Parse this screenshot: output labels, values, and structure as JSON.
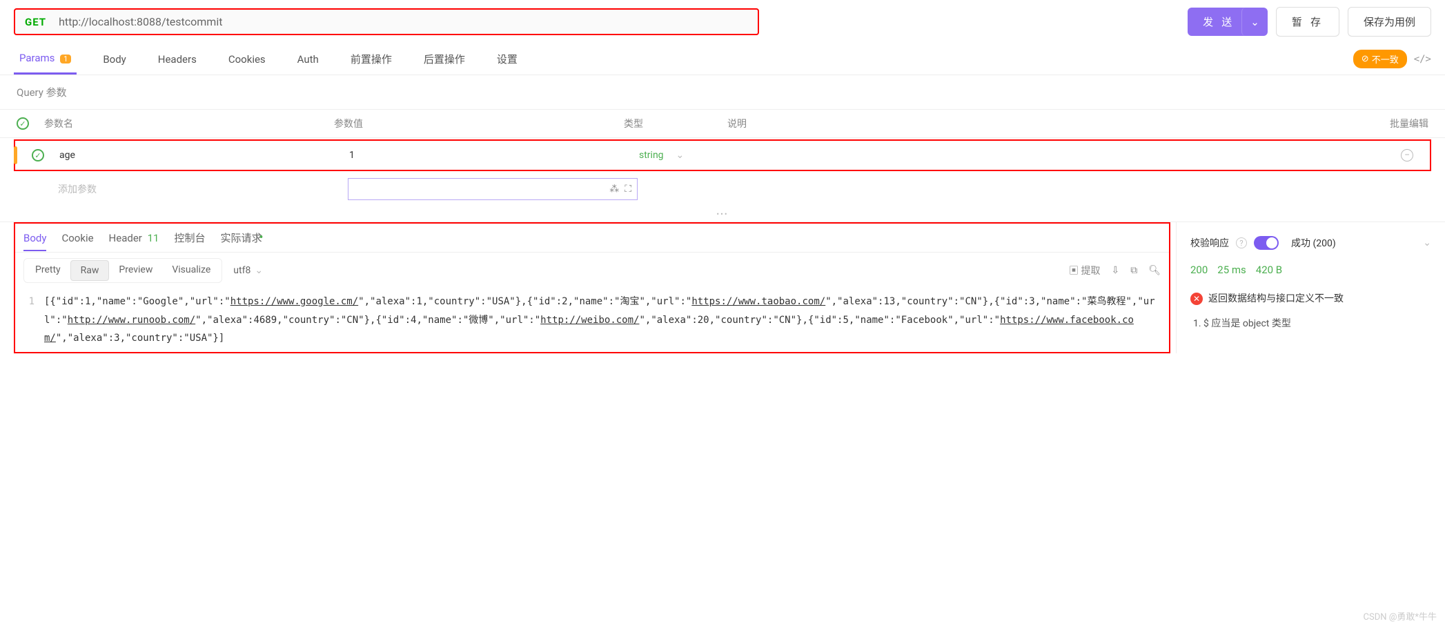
{
  "request": {
    "method": "GET",
    "url": "http://localhost:8088/testcommit"
  },
  "actions": {
    "send": "发 送",
    "save": "暂 存",
    "save_as_case": "保存为用例"
  },
  "tabs": {
    "params": "Params",
    "params_count": "1",
    "body": "Body",
    "headers": "Headers",
    "cookies": "Cookies",
    "auth": "Auth",
    "pre_request": "前置操作",
    "post_request": "后置操作",
    "settings": "设置",
    "mismatch": "不一致"
  },
  "query": {
    "title": "Query 参数",
    "cols": {
      "name": "参数名",
      "value": "参数值",
      "type": "类型",
      "desc": "说明",
      "bulk": "批量编辑"
    },
    "rows": [
      {
        "name": "age",
        "value": "1",
        "type": "string"
      }
    ],
    "add_placeholder": "添加参数"
  },
  "response": {
    "tabs": {
      "body": "Body",
      "cookie": "Cookie",
      "header": "Header",
      "header_count": "11",
      "console": "控制台",
      "actual": "实际请求"
    },
    "views": {
      "pretty": "Pretty",
      "raw": "Raw",
      "preview": "Preview",
      "visualize": "Visualize",
      "encoding": "utf8"
    },
    "extract": "提取",
    "body_text": "[{\"id\":1,\"name\":\"Google\",\"url\":\"https://www.google.cm/\",\"alexa\":1,\"country\":\"USA\"},{\"id\":2,\"name\":\"淘宝\",\"url\":\"https://www.taobao.com/\",\"alexa\":13,\"country\":\"CN\"},{\"id\":3,\"name\":\"菜鸟教程\",\"url\":\"http://www.runoob.com/\",\"alexa\":4689,\"country\":\"CN\"},{\"id\":4,\"name\":\"微博\",\"url\":\"http://weibo.com/\",\"alexa\":20,\"country\":\"CN\"},{\"id\":5,\"name\":\"Facebook\",\"url\":\"https://www.facebook.com/\",\"alexa\":3,\"country\":\"USA\"}]",
    "line_num": "1"
  },
  "sidebar": {
    "validate_label": "校验响应",
    "success_label": "成功 (200)",
    "status_code": "200",
    "time": "25 ms",
    "size": "420 B",
    "error_msg": "返回数据结构与接口定义不一致",
    "error_item": "1. $ 应当是 object 类型"
  },
  "watermark": "CSDN @勇敢*牛牛"
}
